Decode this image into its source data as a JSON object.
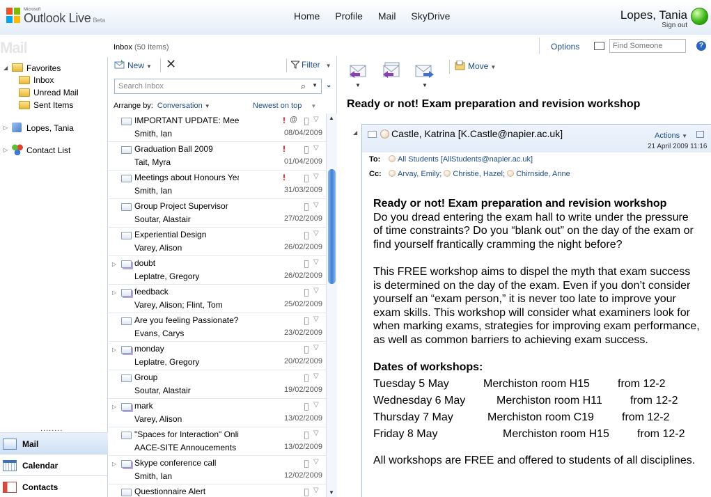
{
  "app": {
    "ms_label": "Microsoft",
    "name": "Outlook Live",
    "badge": "Beta"
  },
  "nav": [
    "Home",
    "Profile",
    "Mail",
    "SkyDrive"
  ],
  "user": {
    "name": "Lopes, Tania",
    "sign_out": "Sign out",
    "presence_color": "#3cb718"
  },
  "section_watermark": "Mail",
  "inbox_header": {
    "label": "Inbox",
    "count": "(50 Items)"
  },
  "options": {
    "label": "Options",
    "find_placeholder": "Find Someone",
    "help": "?"
  },
  "tree": {
    "favorites": "Favorites",
    "folders": [
      "Inbox",
      "Unread Mail",
      "Sent Items"
    ],
    "account": "Lopes, Tania",
    "contacts": "Contact List"
  },
  "bottom_nav": [
    "Mail",
    "Calendar",
    "Contacts"
  ],
  "bottom_dots": "........",
  "toolbar": {
    "new": "New",
    "delete": "✕",
    "filter": "Filter"
  },
  "search": {
    "placeholder": "Search Inbox"
  },
  "arrange": {
    "label": "Arrange by:",
    "value": "Conversation",
    "order": "Newest on top"
  },
  "messages": [
    {
      "subject": "IMPORTANT UPDATE: Meetings abou",
      "from": "Smith, Ian",
      "date": "08/04/2009",
      "important": true,
      "attachment": true,
      "thread": false
    },
    {
      "subject": "Graduation Ball 2009",
      "from": "Tait, Myra",
      "date": "01/04/2009",
      "important": true,
      "attachment": false,
      "thread": false
    },
    {
      "subject": "Meetings about Honours Year",
      "from": "Smith, Ian",
      "date": "31/03/2009",
      "important": true,
      "attachment": false,
      "thread": false
    },
    {
      "subject": "Group Project Supervisor",
      "from": "Soutar, Alastair",
      "date": "27/02/2009",
      "important": false,
      "attachment": false,
      "thread": false
    },
    {
      "subject": "Experiential Design",
      "from": "Varey, Alison",
      "date": "26/02/2009",
      "important": false,
      "attachment": false,
      "thread": false
    },
    {
      "subject": "doubt",
      "from": "Leplatre, Gregory",
      "date": "26/02/2009",
      "important": false,
      "attachment": false,
      "thread": true
    },
    {
      "subject": "feedback",
      "from": "Varey, Alison; Flint, Tom",
      "date": "25/02/2009",
      "important": false,
      "attachment": false,
      "thread": true
    },
    {
      "subject": "Are you feeling Passionate???!",
      "from": "Evans, Carys",
      "date": "23/02/2009",
      "important": false,
      "attachment": false,
      "thread": false
    },
    {
      "subject": "monday",
      "from": "Leplatre, Gregory",
      "date": "20/02/2009",
      "important": false,
      "attachment": false,
      "thread": true
    },
    {
      "subject": "Group",
      "from": "Soutar, Alastair",
      "date": "19/02/2009",
      "important": false,
      "attachment": false,
      "thread": false
    },
    {
      "subject": "mark",
      "from": "Varey, Alison",
      "date": "13/02/2009",
      "important": false,
      "attachment": false,
      "thread": true
    },
    {
      "subject": "\"Spaces for Interaction\" Online Event",
      "from": "AACE-SITE Annoucements",
      "date": "13/02/2009",
      "important": false,
      "attachment": false,
      "thread": false
    },
    {
      "subject": "Skype conference call",
      "from": "Smith, Ian",
      "date": "12/02/2009",
      "important": false,
      "attachment": false,
      "thread": true
    },
    {
      "subject": "Questionnaire Alert",
      "from": "",
      "date": "",
      "important": false,
      "attachment": false,
      "thread": false
    }
  ],
  "reading": {
    "move": "Move",
    "title": "Ready or not! Exam preparation and revision workshop",
    "sender": "Castle, Katrina [K.Castle@napier.ac.uk]",
    "actions": "Actions",
    "sent": "21 April 2009 11:16",
    "to_label": "To:",
    "to": [
      "All Students [AllStudents@napier.ac.uk]"
    ],
    "cc_label": "Cc:",
    "cc": [
      "Arvay, Emily;",
      "Christie, Hazel;",
      "Chirnside, Anne"
    ],
    "body_heading": "Ready or not! Exam preparation and revision workshop",
    "para1": "Do you dread entering the exam hall to write under the pressure of time constraints? Do you “blank out” on the day of the exam or find yourself frantically cramming the night before?",
    "para2": "This FREE workshop aims to dispel the myth that exam success is determined on the day of the exam. Even if you don’t consider yourself an “exam person,” it is never too late to improve your exam skills. This workshop will consider what examiners look for when marking exams, strategies for improving exam performance, as well as common barriers to achieving exam success.",
    "dates_heading": "Dates of workshops:",
    "workshops": [
      {
        "day": "Tuesday 5 May",
        "room": "Merchiston room H15",
        "time": "from 12-2"
      },
      {
        "day": "Wednesday 6 May",
        "room": "Merchiston room H11",
        "time": "from 12-2"
      },
      {
        "day": "Thursday 7 May",
        "room": "Merchiston room C19",
        "time": "from 12-2"
      },
      {
        "day": "Friday 8 May",
        "room": "Merchiston room H15",
        "time": "from 12-2"
      }
    ],
    "para3": "All workshops are FREE and offered to students of all disciplines."
  }
}
